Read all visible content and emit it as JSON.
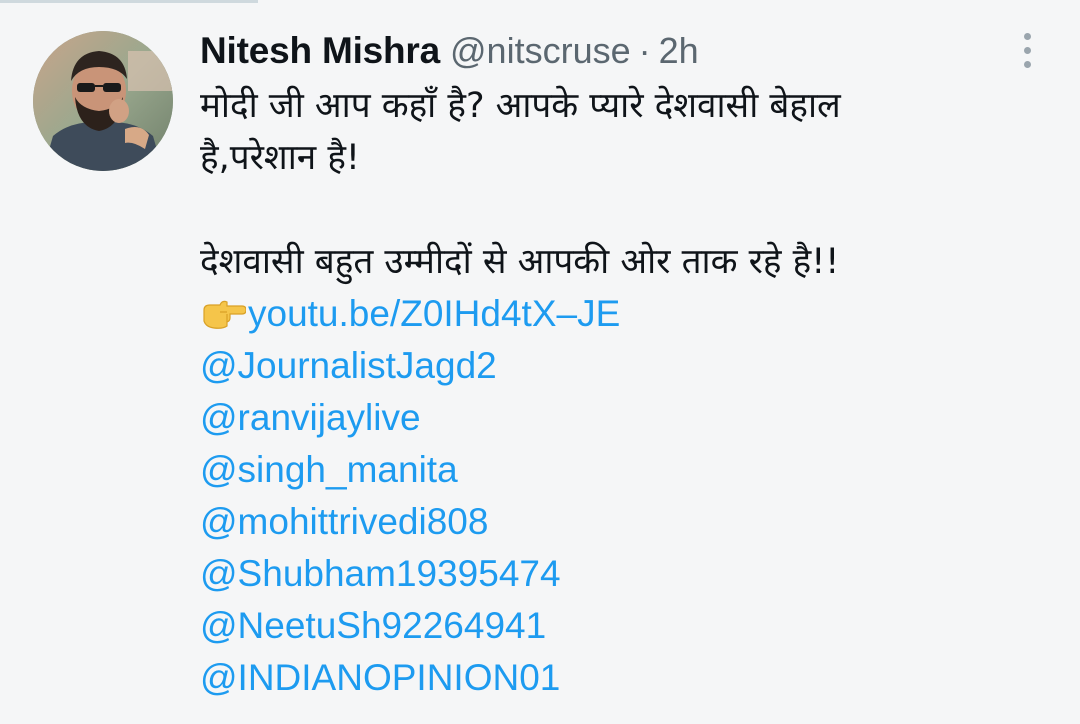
{
  "tweet": {
    "display_name": "Nitesh Mishra",
    "handle": "@nitscruse",
    "separator": "·",
    "time": "2h",
    "text_lines": [
      "मोदी जी आप कहाँ है? आपके प्यारे देशवासी बेहाल",
      "है,परेशान है!",
      "",
      "देशवासी बहुत उम्मीदों से आपकी ओर ताक रहे है!!"
    ],
    "link": {
      "icon": "pointing-right-hand-icon",
      "text": "youtu.be/Z0IHd4tX–JE"
    },
    "mentions": [
      "@JournalistJagd2",
      "@ranvijaylive",
      "@singh_manita",
      "@mohittrivedi808",
      "@Shubham19395474",
      "@NeetuSh92264941",
      "@INDIANOPINION01"
    ]
  },
  "colors": {
    "background": "#f5f6f7",
    "text": "#0f1419",
    "secondary_text": "#5b6770",
    "link": "#1d9bf0"
  }
}
